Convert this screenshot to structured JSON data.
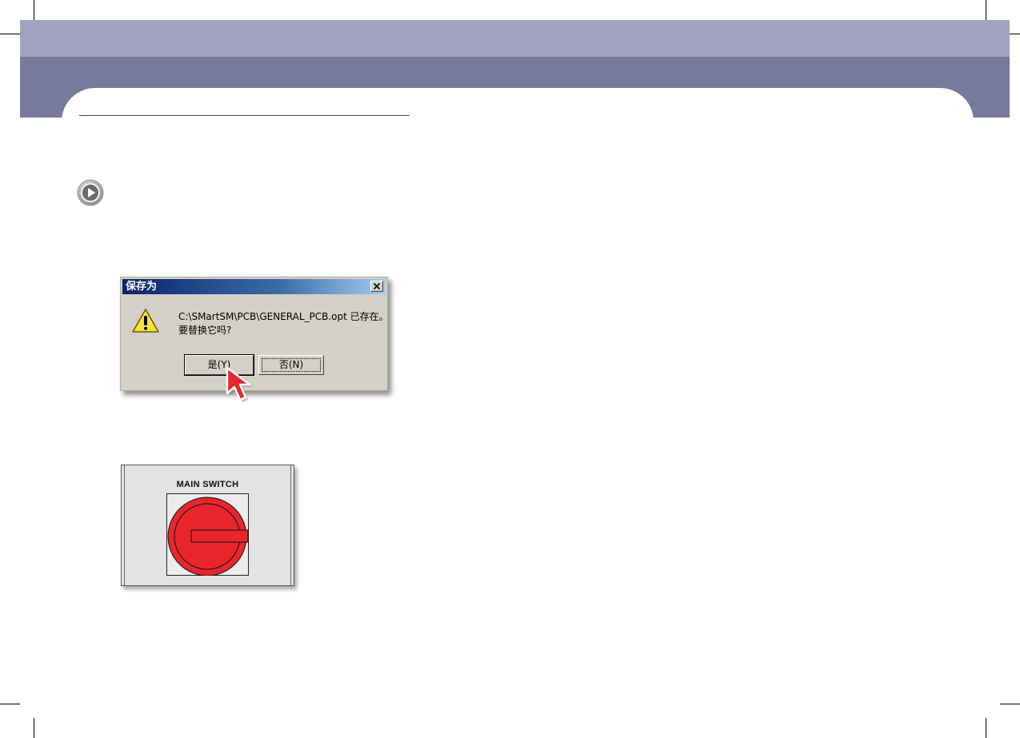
{
  "dialog": {
    "title": "保存为",
    "message": "C:\\SMartSM\\PCB\\GENERAL_PCB.opt 已存在。\n要替换它吗?",
    "yes_label": "是(Y)",
    "no_label": "否(N)",
    "close_icon": "close-icon",
    "warning_icon": "warning-icon"
  },
  "switch_panel": {
    "label": "MAIN  SWITCH",
    "knob_color": "#e8262c"
  },
  "colors": {
    "header_light": "#a3a3c1",
    "header_dark": "#777a9d",
    "cursor": "#e8262c"
  }
}
